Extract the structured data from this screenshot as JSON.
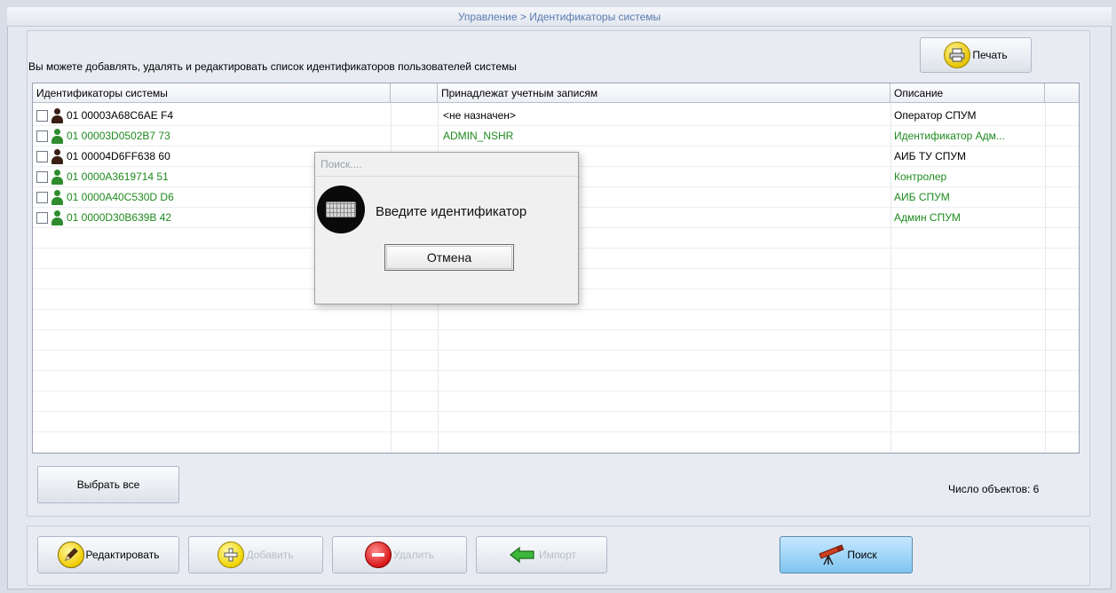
{
  "window": {
    "title": "Управление > Идентификаторы системы"
  },
  "hint": "Вы можете добавлять, удалять и редактировать список идентификаторов пользователей системы",
  "print_button": {
    "label": "Печать",
    "icon": "printer-icon"
  },
  "table": {
    "columns": [
      "Идентификаторы системы",
      "",
      "Принадлежат учетным записям",
      "Описание"
    ],
    "rows": [
      {
        "id": "01 00003A68C6AE F4",
        "account": "<не назначен>",
        "description": "Оператор СПУМ",
        "color": "#000000",
        "checked": false
      },
      {
        "id": "01 00003D0502B7 73",
        "account": "ADMIN_NSHR",
        "description": "Идентификатор Адм...",
        "color": "#1e8a1e",
        "checked": false
      },
      {
        "id": "01 00004D6FF638 60",
        "account": "",
        "description": "АИБ ТУ СПУМ",
        "color": "#000000",
        "checked": false
      },
      {
        "id": "01 0000A3619714 51",
        "account": "",
        "description": "Контролер",
        "color": "#1e8a1e",
        "checked": false
      },
      {
        "id": "01 0000A40C530D D6",
        "account": "",
        "description": "АИБ СПУМ",
        "color": "#1e8a1e",
        "checked": false
      },
      {
        "id": "01 0000D30B639B 42",
        "account": "",
        "description": "Админ СПУМ",
        "color": "#1e8a1e",
        "checked": false
      }
    ]
  },
  "select_all_button": {
    "label": "Выбрать все"
  },
  "count_label": "Число объектов: 6",
  "toolbar": {
    "edit": {
      "label": "Редактировать",
      "icon": "pencil-icon",
      "enabled": true
    },
    "add": {
      "label": "Добавить",
      "icon": "plus-icon",
      "enabled": false
    },
    "delete": {
      "label": "Удалить",
      "icon": "minus-icon",
      "enabled": false
    },
    "import": {
      "label": "Импорт",
      "icon": "arrow-left-icon",
      "enabled": false
    },
    "search": {
      "label": "Поиск",
      "icon": "telescope-icon",
      "enabled": true
    }
  },
  "modal": {
    "title": "Поиск....",
    "message": "Введите идентификатор",
    "cancel_label": "Отмена",
    "icon": "keyboard-icon"
  },
  "colors": {
    "title_text": "#5a7cb0",
    "green_row": "#1e8a1e",
    "search_button": "#7fc4f0"
  }
}
